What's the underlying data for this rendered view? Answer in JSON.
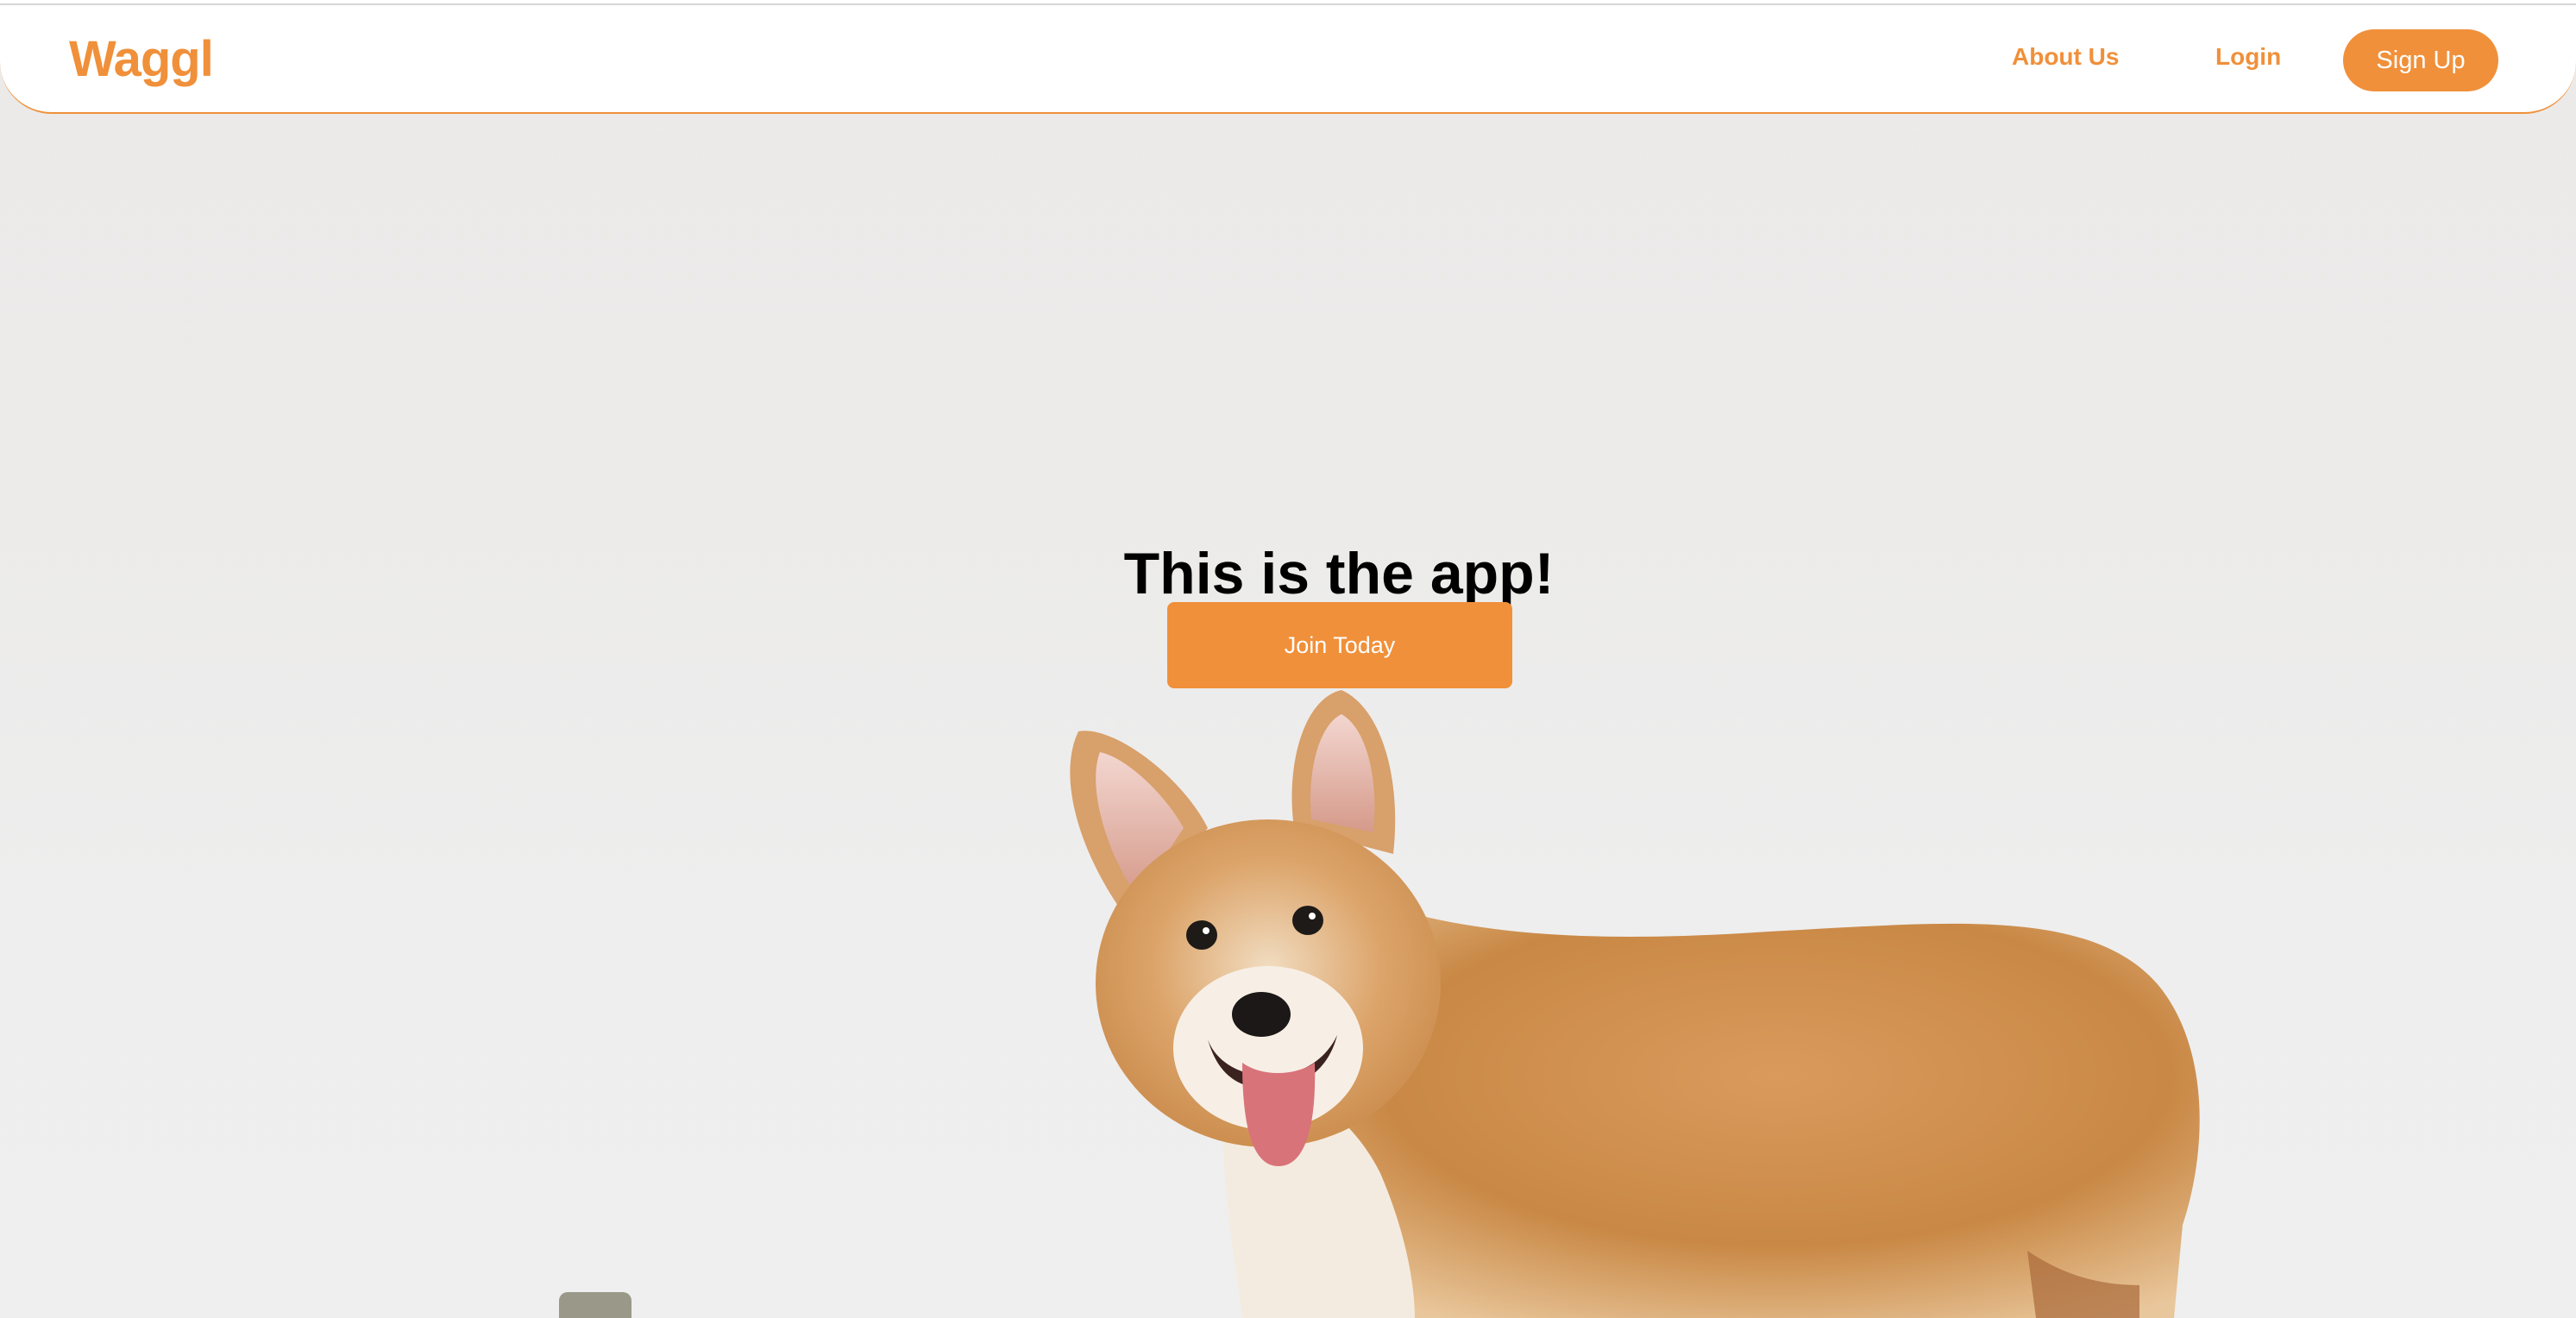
{
  "navbar": {
    "logo": "Waggl",
    "about_label": "About Us",
    "login_label": "Login",
    "signup_label": "Sign Up"
  },
  "hero": {
    "title": "This is the app!",
    "cta_label": "Join Today"
  },
  "colors": {
    "brand": "#f0903a",
    "background": "#ebeae9",
    "text": "#000000"
  },
  "icons": {
    "hero_image": "corgi-photo"
  }
}
